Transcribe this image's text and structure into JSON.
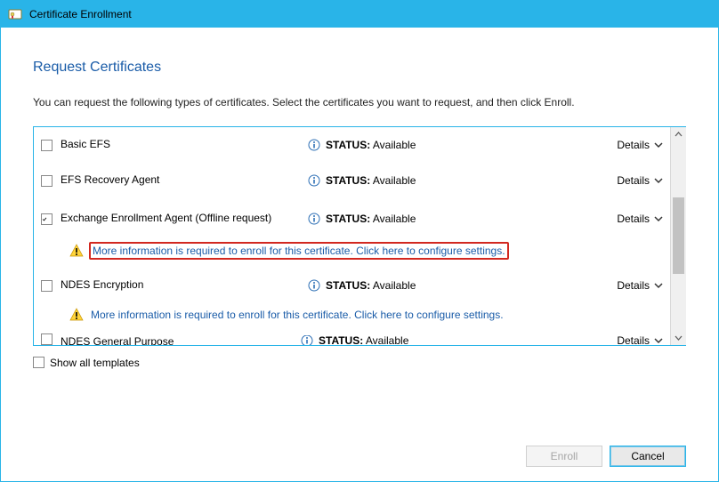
{
  "window": {
    "title": "Certificate Enrollment"
  },
  "heading": "Request Certificates",
  "subtitle": "You can request the following types of certificates. Select the certificates you want to request, and then click Enroll.",
  "status_word": "STATUS:",
  "status_available": "Available",
  "details_label": "Details",
  "more_info_text": "More information is required to enroll for this certificate. Click here to configure settings.",
  "certificates": [
    {
      "name": "Basic EFS",
      "checked": false,
      "needs_more_info": false
    },
    {
      "name": "EFS Recovery Agent",
      "checked": false,
      "needs_more_info": false
    },
    {
      "name": "Exchange Enrollment Agent (Offline request)",
      "checked": true,
      "needs_more_info": true,
      "highlight": true
    },
    {
      "name": "NDES Encryption",
      "checked": false,
      "needs_more_info": true,
      "highlight": false
    }
  ],
  "partial_certificate_name": "NDES General Purpose",
  "show_all_label": "Show all templates",
  "show_all_checked": false,
  "buttons": {
    "enroll": "Enroll",
    "cancel": "Cancel"
  }
}
